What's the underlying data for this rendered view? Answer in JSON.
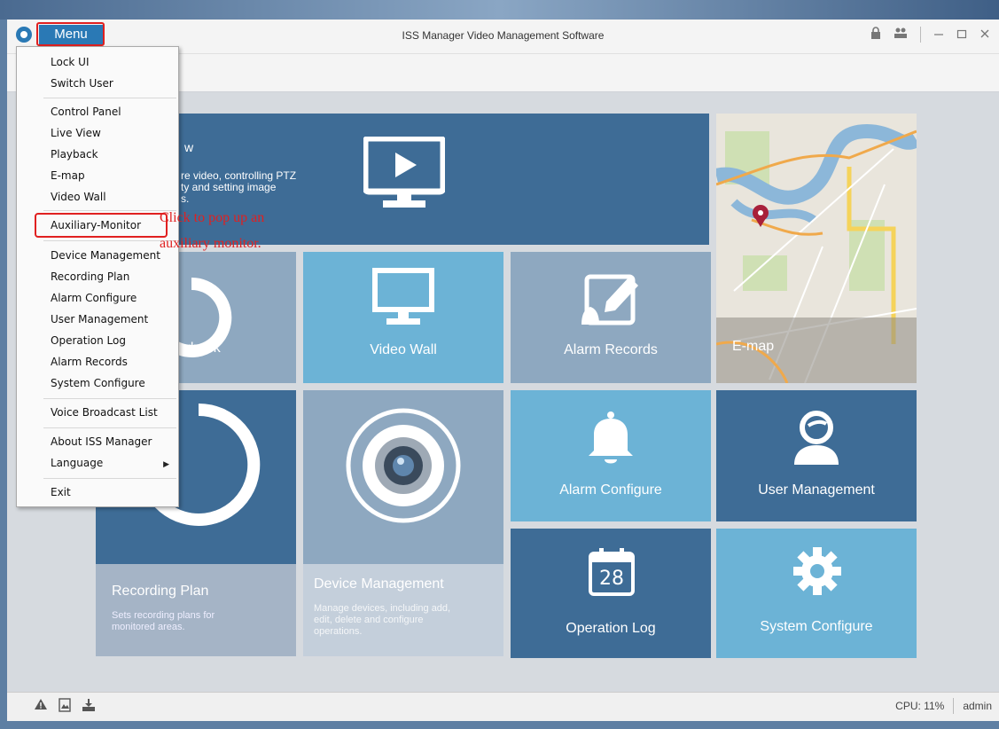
{
  "titlebar": {
    "menu_label": "Menu",
    "title": "ISS Manager Video Management Software"
  },
  "tiles": {
    "live_view": {
      "title": "w",
      "desc1": "re video, controlling PTZ",
      "desc2": "ty and setting image",
      "desc3": "s."
    },
    "playback": {
      "label": "ayback"
    },
    "video_wall": {
      "label": "Video Wall"
    },
    "alarm_records": {
      "label": "Alarm Records"
    },
    "emap": {
      "label": "E-map"
    },
    "recording_plan": {
      "label": "Recording Plan",
      "desc1": "Sets recording plans for",
      "desc2": "monitored areas."
    },
    "device_management": {
      "label": "Device Management",
      "desc1": "Manage devices, including add,",
      "desc2": "edit, delete and configure",
      "desc3": "operations."
    },
    "alarm_configure": {
      "label": "Alarm Configure"
    },
    "user_management": {
      "label": "User Management"
    },
    "operation_log": {
      "label": "Operation Log",
      "day": "28"
    },
    "system_configure": {
      "label": "System Configure"
    }
  },
  "menu": {
    "items": [
      "Lock UI",
      "Switch User",
      "Control Panel",
      "Live View",
      "Playback",
      "E-map",
      "Video Wall",
      "Auxiliary-Monitor",
      "Device Management",
      "Recording Plan",
      "Alarm Configure",
      "User Management",
      "Operation Log",
      "Alarm Records",
      "System Configure",
      "Voice Broadcast List",
      "About ISS Manager",
      "Language",
      "Exit"
    ]
  },
  "annotation": {
    "line1": "Click to pop up an",
    "line2": "auxiliary monitor."
  },
  "status": {
    "cpu": "CPU: 11%",
    "user": "admin"
  },
  "colors": {
    "dark_tile": "#3e6c96",
    "light_tile": "#6cb3d6",
    "grey_tile": "#8ea8c0",
    "accent": "#2a79b5",
    "annotation": "#e02020"
  }
}
